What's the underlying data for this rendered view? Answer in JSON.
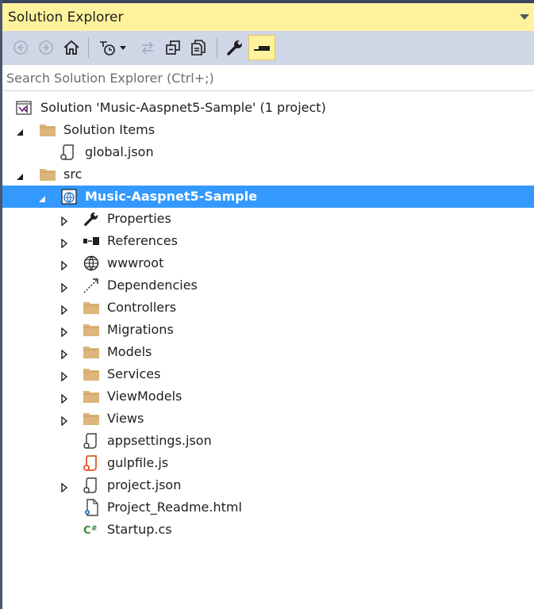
{
  "window": {
    "title": "Solution Explorer"
  },
  "toolbar": {
    "buttons": [
      {
        "icon": "back-arrow-icon"
      },
      {
        "icon": "forward-arrow-icon"
      },
      {
        "icon": "home-icon"
      },
      {
        "icon": "pending-changes-filter-icon"
      },
      {
        "icon": "sync-with-active-document-icon"
      },
      {
        "icon": "collapse-all-icon"
      },
      {
        "icon": "show-all-files-icon"
      },
      {
        "icon": "properties-wrench-icon"
      },
      {
        "icon": "preview-selected-items-icon",
        "active": true
      }
    ],
    "accent": "#fff29d"
  },
  "search": {
    "placeholder": "Search Solution Explorer (Ctrl+;)"
  },
  "tree": {
    "solution": "Solution 'Music-Aaspnet5-Sample' (1 project)",
    "solution_items": "Solution Items",
    "global_json": "global.json",
    "src": "src",
    "project": "Music-Aaspnet5-Sample",
    "properties": "Properties",
    "references": "References",
    "wwwroot": "wwwroot",
    "dependencies": "Dependencies",
    "controllers": "Controllers",
    "migrations": "Migrations",
    "models": "Models",
    "services": "Services",
    "viewmodels": "ViewModels",
    "views": "Views",
    "appsettings": "appsettings.json",
    "gulpfile": "gulpfile.js",
    "project_json": "project.json",
    "readme": "Project_Readme.html",
    "startup": "Startup.cs"
  },
  "colors": {
    "selection": "#3399ff",
    "folder": "#dcb67a",
    "toolbar_bg": "#cfd6e5"
  }
}
